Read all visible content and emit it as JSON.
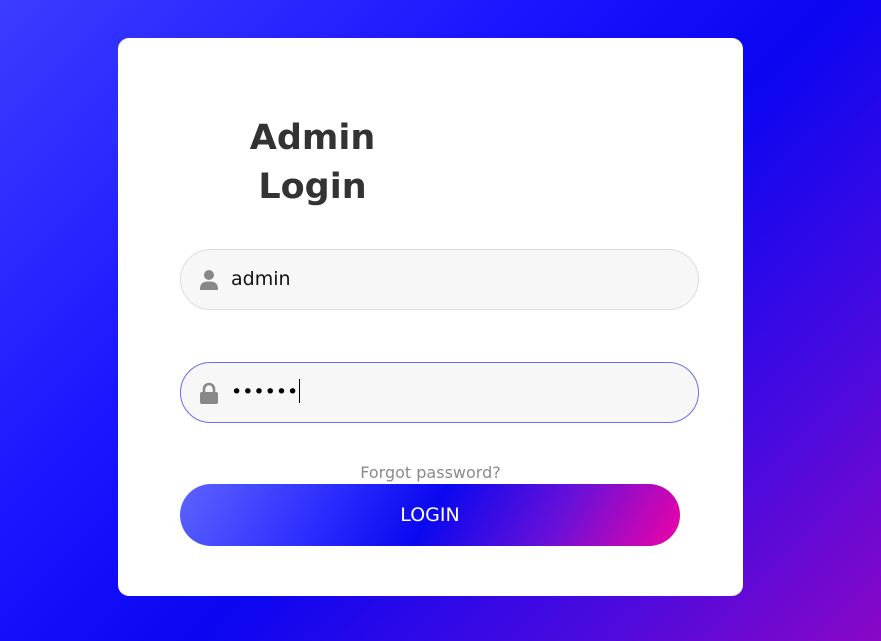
{
  "login_form": {
    "title_line1": "Admin",
    "title_line2": "Login",
    "username": {
      "value": "admin",
      "icon": "user-icon"
    },
    "password": {
      "value": "••••••",
      "icon": "lock-icon"
    },
    "forgot_link": "Forgot password?",
    "login_button": "LOGIN"
  },
  "colors": {
    "background_start": "#3a3dff",
    "background_end": "#8a07c6",
    "button_gradient_start": "#5d63ff",
    "button_gradient_end": "#f002a6",
    "title_color": "#333333",
    "focus_border": "#6a6ef0"
  }
}
